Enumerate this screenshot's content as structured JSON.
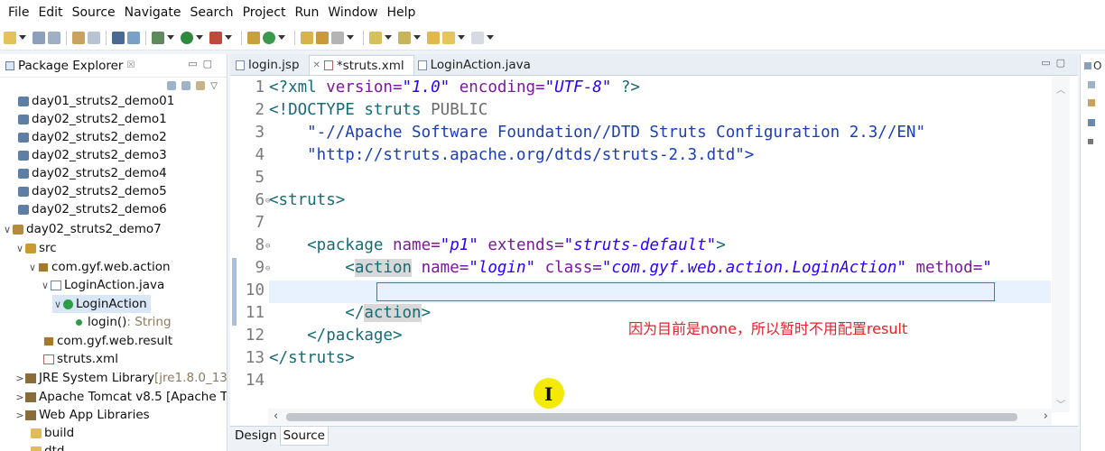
{
  "menu": [
    "File",
    "Edit",
    "Source",
    "Navigate",
    "Search",
    "Project",
    "Run",
    "Window",
    "Help"
  ],
  "left_panel": {
    "title": "Package Explorer",
    "close": "☒",
    "tree": [
      {
        "label": "day01_struts2_demo01",
        "twisty": "",
        "icon": "project-icon"
      },
      {
        "label": "day02_struts2_demo1",
        "twisty": "",
        "icon": "project-icon"
      },
      {
        "label": "day02_struts2_demo2",
        "twisty": "",
        "icon": "project-icon"
      },
      {
        "label": "day02_struts2_demo3",
        "twisty": "",
        "icon": "project-icon"
      },
      {
        "label": "day02_struts2_demo4",
        "twisty": "",
        "icon": "project-icon"
      },
      {
        "label": "day02_struts2_demo5",
        "twisty": "",
        "icon": "project-icon"
      },
      {
        "label": "day02_struts2_demo6",
        "twisty": "",
        "icon": "project-icon"
      },
      {
        "label": "day02_struts2_demo7",
        "twisty": "∨",
        "icon": "web-project-icon"
      },
      {
        "label": "src",
        "twisty": "∨",
        "icon": "source-folder-icon"
      },
      {
        "label": "com.gyf.web.action",
        "twisty": "∨",
        "icon": "package-icon"
      },
      {
        "label": "LoginAction.java",
        "twisty": "∨",
        "icon": "java-file-icon"
      },
      {
        "label": "LoginAction",
        "twisty": "∨",
        "icon": "class-icon"
      },
      {
        "label": "login()",
        "suffix": " : String",
        "twisty": "",
        "icon": "method-icon"
      },
      {
        "label": "com.gyf.web.result",
        "twisty": "",
        "icon": "package-icon"
      },
      {
        "label": "struts.xml",
        "twisty": "",
        "icon": "xml-file-icon"
      },
      {
        "label": "JRE System Library",
        "suffix": " [jre1.8.0_13",
        "twisty": ">",
        "icon": "library-icon"
      },
      {
        "label": "Apache Tomcat v8.5 [Apache T",
        "twisty": ">",
        "icon": "library-icon"
      },
      {
        "label": "Web App Libraries",
        "twisty": ">",
        "icon": "library-icon"
      },
      {
        "label": "build",
        "twisty": "",
        "icon": "folder-icon"
      },
      {
        "label": "dtd",
        "twisty": "",
        "icon": "folder-icon"
      }
    ]
  },
  "editor": {
    "tabs": [
      {
        "label": "login.jsp",
        "active": false
      },
      {
        "label": "*struts.xml",
        "active": true
      },
      {
        "label": "LoginAction.java",
        "active": false
      }
    ],
    "line_numbers": [
      "1",
      "2",
      "3",
      "4",
      "5",
      "6",
      "7",
      "8",
      "9",
      "10",
      "11",
      "12",
      "13",
      "14"
    ],
    "code": {
      "l1_open": "<?xml ",
      "l1_a1": "version=",
      "l1_v1": "\"1.0\"",
      "l1_a2": " encoding=",
      "l1_v2": "\"UTF-8\"",
      "l1_close": " ?>",
      "l2_open": "<!DOCTYPE struts ",
      "l2_public": "PUBLIC",
      "l3": "    \"-//Apache Software Foundation//DTD Struts Configuration 2.3//EN\"",
      "l4": "    \"http://struts.apache.org/dtds/struts-2.3.dtd\">",
      "l6": "<struts>",
      "l8_open": "    <package ",
      "l8_a1": "name=",
      "l8_v1": "\"p1\"",
      "l8_a2": " extends=",
      "l8_v2": "\"struts-default\"",
      "l8_close": ">",
      "l9_lt": "        <",
      "l9_tag": "action",
      "l9_a1": " name=",
      "l9_v1": "\"login\"",
      "l9_a2": " class=",
      "l9_v2": "\"com.gyf.web.action.LoginAction\"",
      "l9_a3": " method=",
      "l9_v3": "\"",
      "l11_lt": "        </",
      "l11_tag": "action",
      "l11_gt": ">",
      "l12": "    </package>",
      "l13": "</struts>"
    },
    "annotation": "因为目前是none，所以暂时不用配置result",
    "bottom_tabs": [
      "Design",
      "Source"
    ]
  },
  "right_panel": {
    "title": "O"
  },
  "colors": {
    "annotation": "#e8202a",
    "tag": "#176b77",
    "attr": "#7a1a9c",
    "string": "#2a00ff",
    "cursor_highlight": "#f4e900"
  }
}
